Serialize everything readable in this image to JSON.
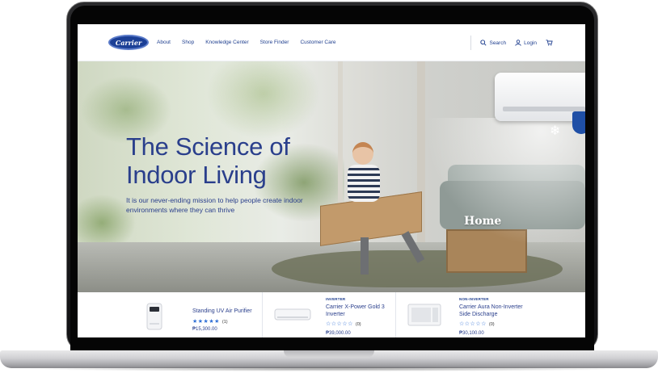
{
  "nav": {
    "logo_text": "Carrier",
    "links": [
      "About",
      "Shop",
      "Knowledge Center",
      "Store Finder",
      "Customer Care"
    ],
    "search_label": "Search",
    "login_label": "Login"
  },
  "hero": {
    "title_line1": "The Science of",
    "title_line2": "Indoor Living",
    "subtitle": "It is our never-ending mission to help people create indoor environments where they can thrive",
    "home_sign": "Home"
  },
  "products": [
    {
      "tag": "",
      "name": "Standing UV Air Purifier",
      "stars": "★★★★★",
      "count": "(1)",
      "price": "₱15,300.00"
    },
    {
      "tag": "INVERTER",
      "name": "Carrier X-Power Gold 3 Inverter",
      "stars": "☆☆☆☆☆",
      "count": "(0)",
      "price": "₱39,000.00"
    },
    {
      "tag": "NON-INVERTER",
      "name": "Carrier Aura Non-Inverter Side Discharge",
      "stars": "☆☆☆☆☆",
      "count": "(0)",
      "price": "₱30,100.00"
    }
  ],
  "colors": {
    "brand": "#1b3f96",
    "text_blue": "#2a3f8c",
    "star": "#2f6fd6"
  }
}
